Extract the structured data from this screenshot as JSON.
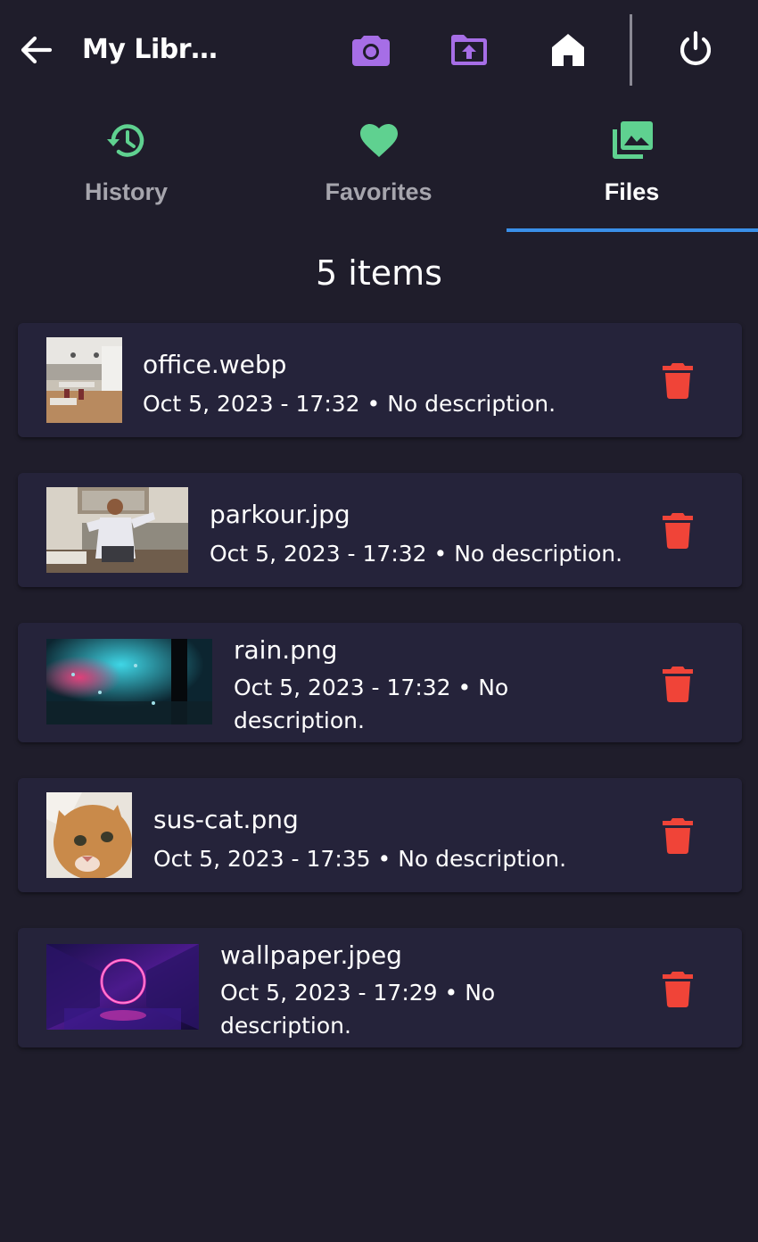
{
  "header": {
    "title": "My Libr…",
    "icons": [
      "back-arrow-icon",
      "camera-icon",
      "folder-upload-icon",
      "home-icon",
      "power-icon"
    ]
  },
  "colors": {
    "background": "#1f1d2b",
    "card": "#25233a",
    "accent_purple": "#a66ee6",
    "accent_green": "#5fd190",
    "indicator_blue": "#3a8fe8",
    "delete_red": "#f04438"
  },
  "tabs": [
    {
      "label": "History",
      "icon": "history-icon",
      "active": false
    },
    {
      "label": "Favorites",
      "icon": "heart-icon",
      "active": false
    },
    {
      "label": "Files",
      "icon": "photo-library-icon",
      "active": true
    }
  ],
  "list": {
    "count_label": "5 items",
    "items": [
      {
        "name": "office.webp",
        "meta": "Oct 5, 2023 - 17:32 • No description.",
        "thumbnail": "office-photo"
      },
      {
        "name": "parkour.jpg",
        "meta": "Oct 5, 2023 - 17:32 • No description.",
        "thumbnail": "person-on-couch-photo"
      },
      {
        "name": "rain.png",
        "meta": "Oct 5, 2023 - 17:32 • No description.",
        "thumbnail": "rainy-window-photo"
      },
      {
        "name": "sus-cat.png",
        "meta": "Oct 5, 2023 - 17:35 • No description.",
        "thumbnail": "orange-cat-photo"
      },
      {
        "name": "wallpaper.jpeg",
        "meta": "Oct 5, 2023 - 17:29 • No description.",
        "thumbnail": "neon-ring-wallpaper"
      }
    ]
  }
}
